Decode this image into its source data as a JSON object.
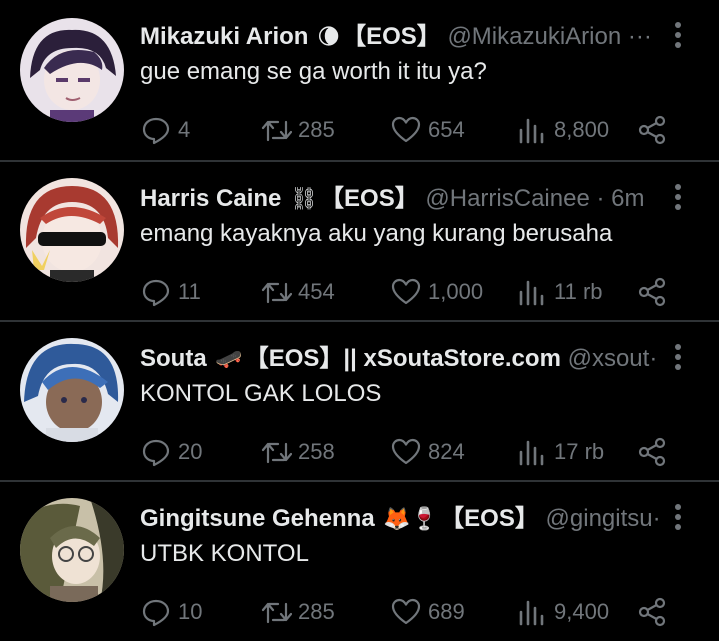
{
  "colors": {
    "background": "#000000",
    "text": "#e7e9ea",
    "muted": "#71767b",
    "divider": "#2f3336"
  },
  "tweets": [
    {
      "name": "Mikazuki Arion",
      "emoji": "🌘",
      "tag": "【EOS】",
      "handle": "@MikazukiArion",
      "dot": "",
      "time": "",
      "ellipsis": "···",
      "text": "gue emang se ga worth it itu ya?",
      "replies": "4",
      "retweets": "285",
      "likes": "654",
      "views": "8,800"
    },
    {
      "name": "Harris Caine",
      "emoji": "⛓",
      "tag": "【EOS】",
      "handle": "@HarrisCainee",
      "dot": "·",
      "time": "6m",
      "ellipsis": "",
      "text": "emang kayaknya aku yang kurang berusaha",
      "replies": "11",
      "retweets": "454",
      "likes": "1,000",
      "views": "11 rb"
    },
    {
      "name": "Souta",
      "emoji": "🛹",
      "tag": "【EOS】|| xSoutaStore.com",
      "handle": "@xsout",
      "dot": "",
      "time": "",
      "ellipsis": "···",
      "text": "KONTOL GAK LOLOS",
      "replies": "20",
      "retweets": "258",
      "likes": "824",
      "views": "17 rb"
    },
    {
      "name": "Gingitsune Gehenna",
      "emoji": "🦊🍷",
      "tag": "【EOS】",
      "handle": "@gingitsu",
      "dot": "",
      "time": "",
      "ellipsis": "···",
      "text": "UTBK KONTOL",
      "replies": "10",
      "retweets": "285",
      "likes": "689",
      "views": "9,400"
    }
  ]
}
